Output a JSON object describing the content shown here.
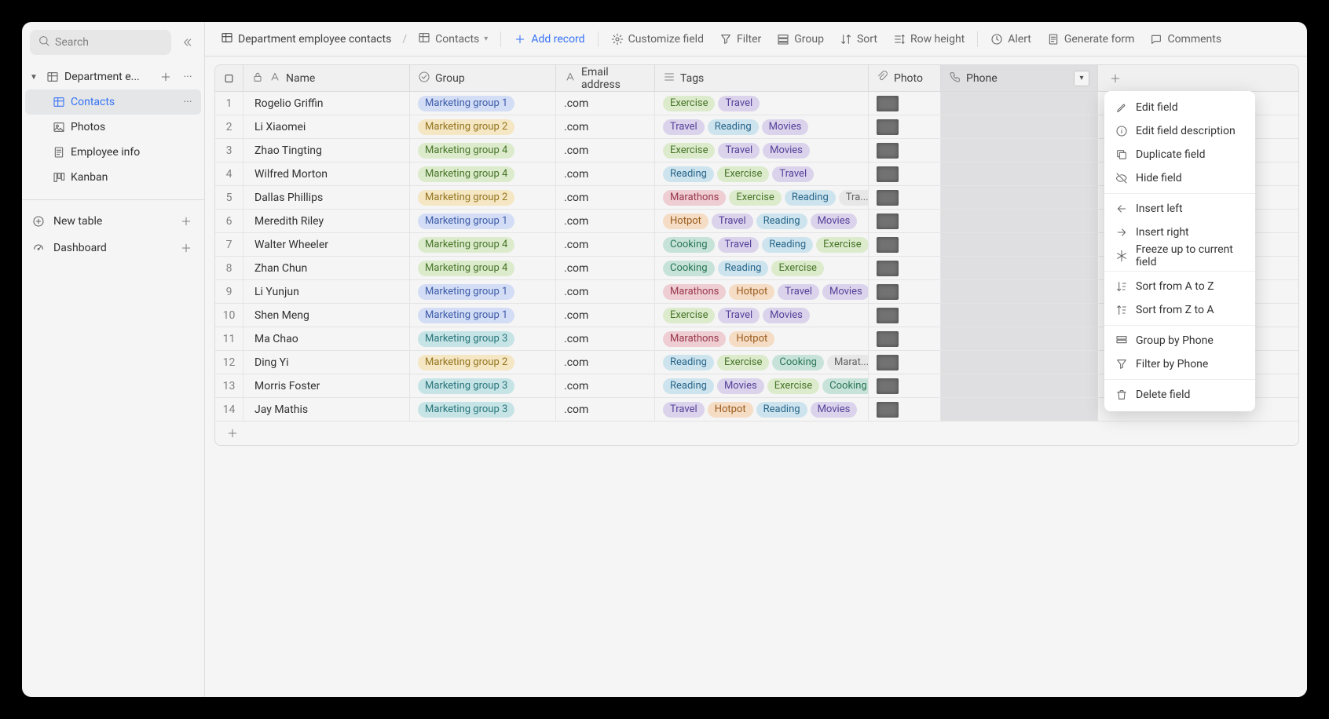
{
  "sidebar": {
    "search_placeholder": "Search",
    "base_name": "Department e...",
    "views": [
      {
        "label": "Contacts",
        "icon": "grid",
        "active": true
      },
      {
        "label": "Photos",
        "icon": "gallery",
        "active": false
      },
      {
        "label": "Employee info",
        "icon": "form",
        "active": false
      },
      {
        "label": "Kanban",
        "icon": "kanban",
        "active": false
      }
    ],
    "pinned": [
      {
        "label": "New table",
        "icon": "plus-circle"
      },
      {
        "label": "Dashboard",
        "icon": "gauge"
      }
    ]
  },
  "toolbar": {
    "crumb_base": "Department employee contacts",
    "crumb_view": "Contacts",
    "add_record": "Add record",
    "buttons": {
      "customize": "Customize field",
      "filter": "Filter",
      "group": "Group",
      "sort": "Sort",
      "row_height": "Row height",
      "alert": "Alert",
      "gen_form": "Generate form",
      "comments": "Comments"
    }
  },
  "columns": {
    "name": "Name",
    "group": "Group",
    "email": "Email address",
    "tags": "Tags",
    "photo": "Photo",
    "phone": "Phone"
  },
  "group_colors": {
    "Marketing group 1": "tg-mg1",
    "Marketing group 2": "tg-mg2",
    "Marketing group 3": "tg-mg3",
    "Marketing group 4": "tg-mg4"
  },
  "tag_colors": {
    "Exercise": "tg-exercise",
    "Travel": "tg-travel",
    "Reading": "tg-reading",
    "Movies": "tg-movies",
    "Marathons": "tg-marathons",
    "Hotpot": "tg-hotpot",
    "Cooking": "tg-cooking"
  },
  "rows": [
    {
      "name": "Rogelio Griffin",
      "group": "Marketing group 1",
      "email": ".com",
      "tags": [
        "Exercise",
        "Travel"
      ]
    },
    {
      "name": "Li Xiaomei",
      "group": "Marketing group 2",
      "email": ".com",
      "tags": [
        "Travel",
        "Reading",
        "Movies"
      ]
    },
    {
      "name": "Zhao Tingting",
      "group": "Marketing group 4",
      "email": ".com",
      "tags": [
        "Exercise",
        "Travel",
        "Movies"
      ]
    },
    {
      "name": "Wilfred Morton",
      "group": "Marketing group 4",
      "email": ".com",
      "tags": [
        "Reading",
        "Exercise",
        "Travel"
      ]
    },
    {
      "name": "Dallas Phillips",
      "group": "Marketing group 2",
      "email": ".com",
      "tags": [
        "Marathons",
        "Exercise",
        "Reading",
        "Travel"
      ],
      "tags_trunc": "Tra..."
    },
    {
      "name": "Meredith Riley",
      "group": "Marketing group 1",
      "email": ".com",
      "tags": [
        "Hotpot",
        "Travel",
        "Reading",
        "Movies"
      ]
    },
    {
      "name": "Walter Wheeler",
      "group": "Marketing group 4",
      "email": ".com",
      "tags": [
        "Cooking",
        "Travel",
        "Reading",
        "Exercise"
      ]
    },
    {
      "name": "Zhan Chun",
      "group": "Marketing group 4",
      "email": ".com",
      "tags": [
        "Cooking",
        "Reading",
        "Exercise"
      ]
    },
    {
      "name": "Li Yunjun",
      "group": "Marketing group 1",
      "email": ".com",
      "tags": [
        "Marathons",
        "Hotpot",
        "Travel",
        "Movies"
      ]
    },
    {
      "name": "Shen Meng",
      "group": "Marketing group 1",
      "email": ".com",
      "tags": [
        "Exercise",
        "Travel",
        "Movies"
      ]
    },
    {
      "name": "Ma Chao",
      "group": "Marketing group 3",
      "email": ".com",
      "tags": [
        "Marathons",
        "Hotpot"
      ]
    },
    {
      "name": "Ding Yi",
      "group": "Marketing group 2",
      "email": ".com",
      "tags": [
        "Reading",
        "Exercise",
        "Cooking",
        "Marathons"
      ],
      "tags_trunc": "Marat..."
    },
    {
      "name": "Morris Foster",
      "group": "Marketing group 3",
      "email": ".com",
      "tags": [
        "Reading",
        "Movies",
        "Exercise",
        "Cooking"
      ]
    },
    {
      "name": "Jay Mathis",
      "group": "Marketing group 3",
      "email": ".com",
      "tags": [
        "Travel",
        "Hotpot",
        "Reading",
        "Movies"
      ]
    }
  ],
  "context_menu": [
    {
      "label": "Edit field",
      "icon": "pencil"
    },
    {
      "label": "Edit field description",
      "icon": "info"
    },
    {
      "label": "Duplicate field",
      "icon": "copy"
    },
    {
      "label": "Hide field",
      "icon": "eye-off"
    },
    "---",
    {
      "label": "Insert left",
      "icon": "arrow-left"
    },
    {
      "label": "Insert right",
      "icon": "arrow-right"
    },
    {
      "label": "Freeze up to current field",
      "icon": "snowflake"
    },
    "---",
    {
      "label": "Sort from A to Z",
      "icon": "sort-az"
    },
    {
      "label": "Sort from Z to A",
      "icon": "sort-za"
    },
    "---",
    {
      "label": "Group by Phone",
      "icon": "group"
    },
    {
      "label": "Filter by Phone",
      "icon": "filter"
    },
    "---",
    {
      "label": "Delete field",
      "icon": "trash"
    }
  ]
}
